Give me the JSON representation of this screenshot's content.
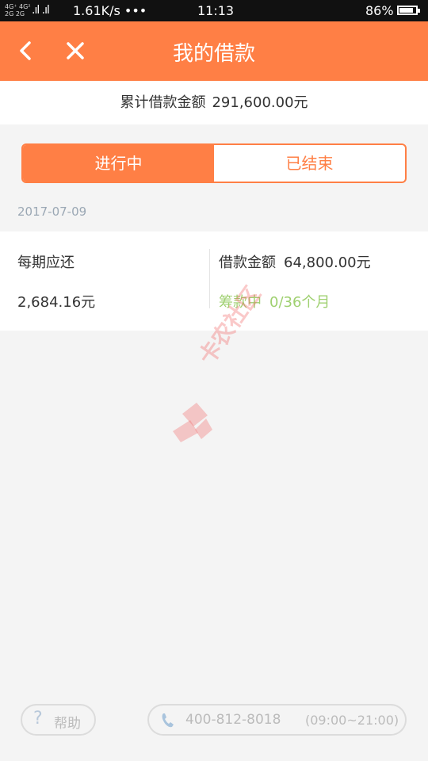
{
  "status_bar": {
    "signal_text": "4G⁺ 4G²\n2G 2G",
    "bars": "..ıl ..ıl",
    "speed": "1.61K/s •••",
    "time": "11:13",
    "battery": "86%",
    "battery_level": 0.86
  },
  "header": {
    "title": "我的借款",
    "back_icon": "chevron-left-icon",
    "close_icon": "close-icon",
    "color": "#ff7f45"
  },
  "total": {
    "label": "累计借款金额",
    "amount": "291,600.00元"
  },
  "tabs": [
    {
      "label": "进行中",
      "active": true
    },
    {
      "label": "已结束",
      "active": false
    }
  ],
  "loan": {
    "date": "2017-07-09",
    "per_period_label": "每期应还",
    "per_period_value": "2,684.16元",
    "amount_label": "借款金额",
    "amount_value": "64,800.00元",
    "status_label": "筹款中",
    "status_progress": "0/36个月",
    "status_color": "#9fd070"
  },
  "watermark": {
    "text": "卡农社区"
  },
  "footer": {
    "help_label": "帮助",
    "help_icon": "question-icon",
    "phone_icon": "phone-icon",
    "phone_number": "400-812-8018",
    "phone_hours": "(09:00~21:00)"
  }
}
